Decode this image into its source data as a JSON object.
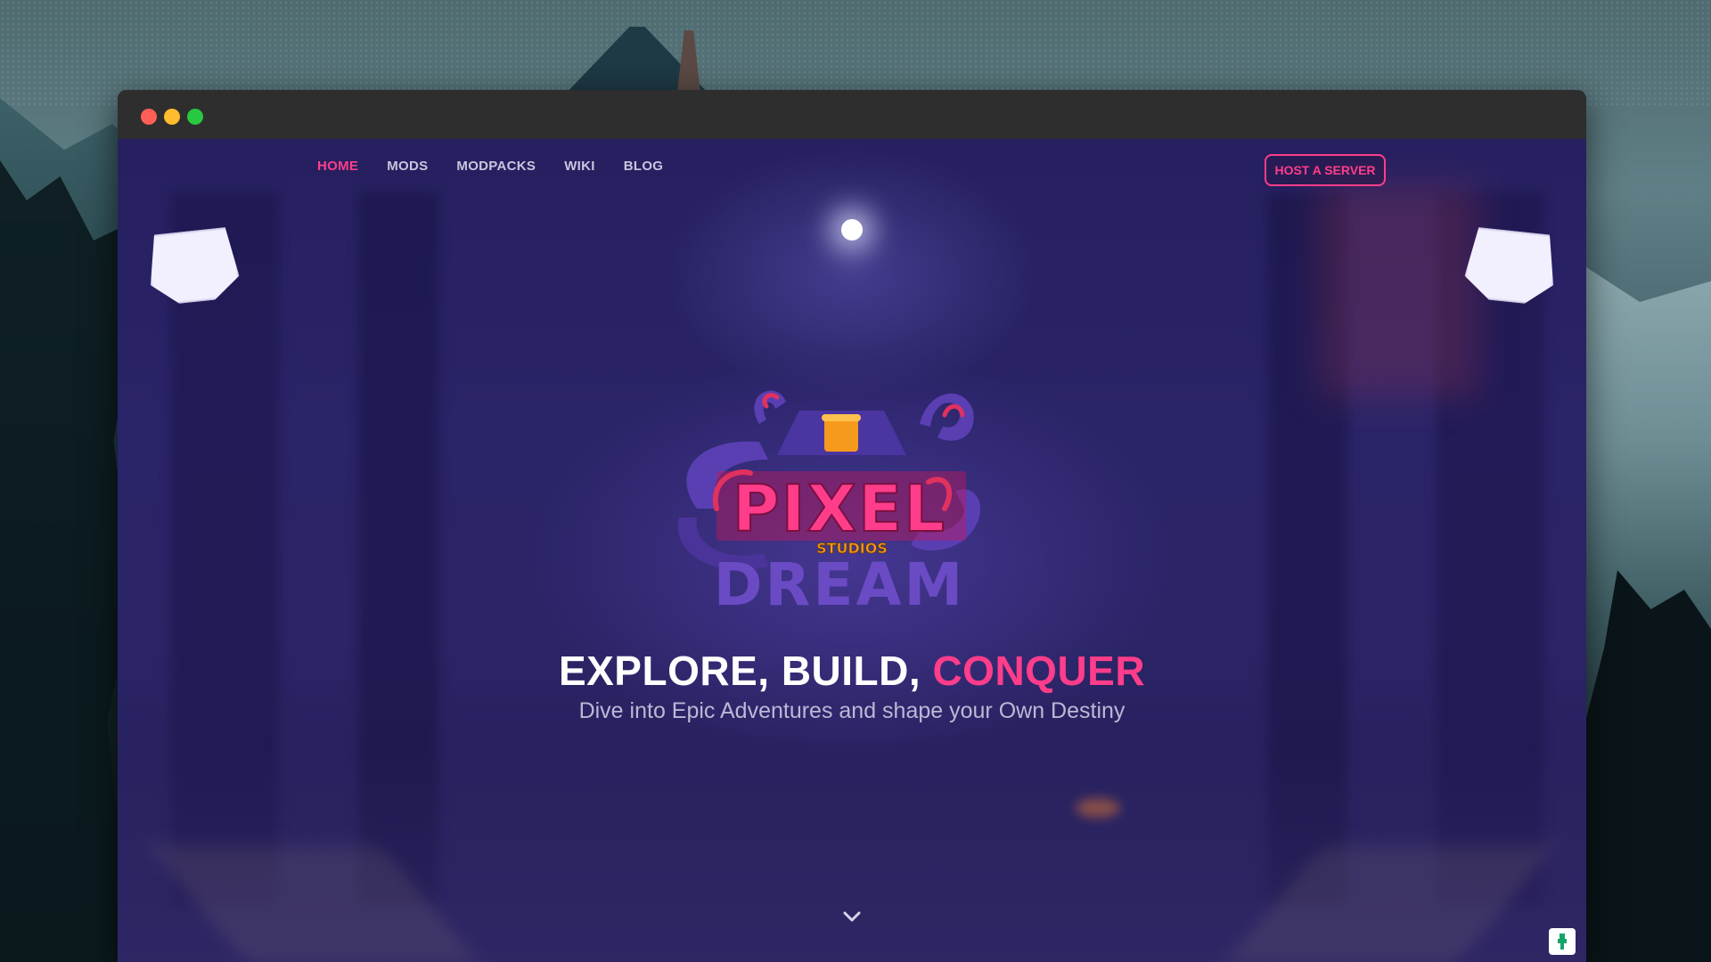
{
  "window": {
    "controls": [
      "close",
      "minimize",
      "maximize"
    ]
  },
  "nav": {
    "items": [
      {
        "label": "HOME",
        "active": true
      },
      {
        "label": "MODS",
        "active": false
      },
      {
        "label": "MODPACKS",
        "active": false
      },
      {
        "label": "WIKI",
        "active": false
      },
      {
        "label": "BLOG",
        "active": false
      }
    ],
    "cta_label": "HOST A SERVER"
  },
  "logo": {
    "word_top": "PIXEL",
    "word_middle": "STUDIOS",
    "word_bottom": "DREAM"
  },
  "hero": {
    "headline_part1": "EXPLORE, BUILD,",
    "headline_accent": "CONQUER",
    "subheadline": "Dive into Epic Adventures and shape your Own Destiny"
  },
  "colors": {
    "accent": "#ff3d8a",
    "background": "#2a2468",
    "logo_purple": "#6a4bc4",
    "logo_orange": "#f59a1c"
  },
  "icons": {
    "scroll": "chevron-down-icon",
    "helper": "help-widget-icon"
  }
}
